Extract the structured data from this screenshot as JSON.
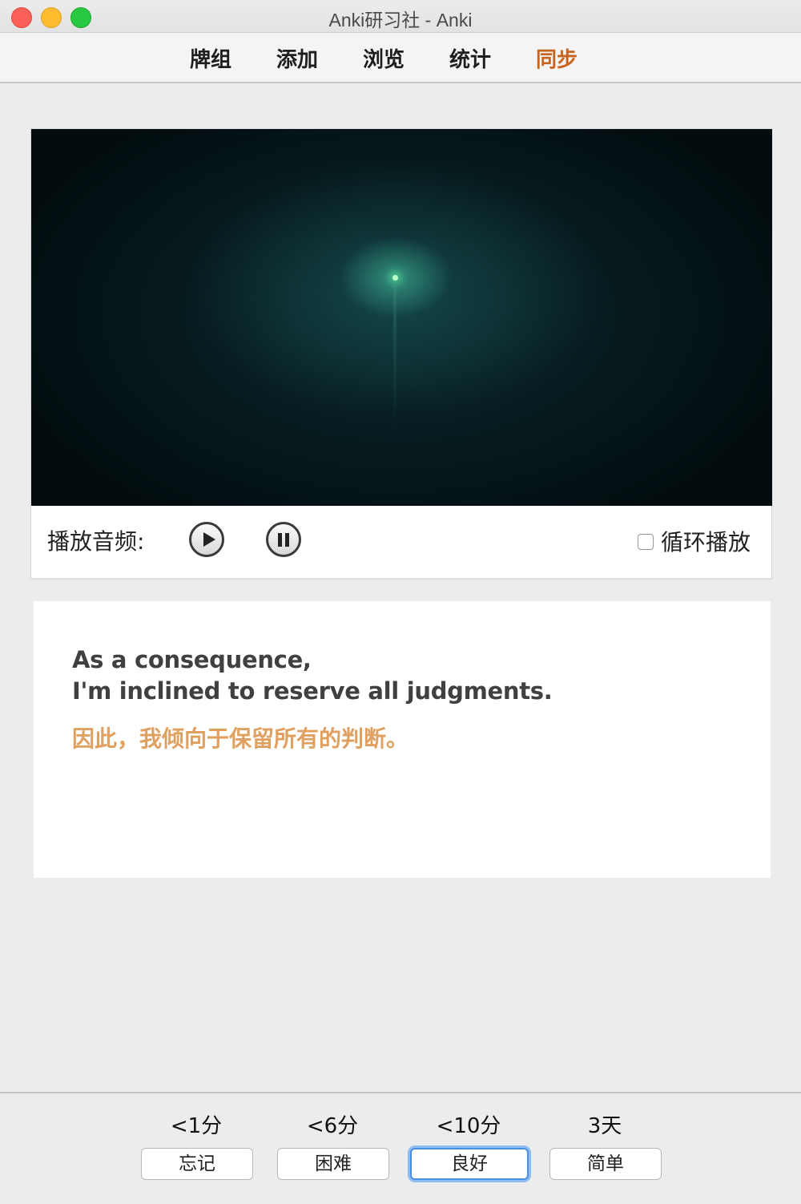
{
  "window": {
    "title": "Anki研习社 - Anki"
  },
  "toolbar": {
    "items": [
      {
        "label": "牌组"
      },
      {
        "label": "添加"
      },
      {
        "label": "浏览"
      },
      {
        "label": "统计"
      },
      {
        "label": "同步"
      }
    ],
    "sync_color": "#c8641e"
  },
  "media": {
    "audio_label": "播放音频:",
    "loop_label": "循环播放",
    "loop_checked": false,
    "play_icon": "play-icon",
    "pause_icon": "pause-icon"
  },
  "card": {
    "english_line1": "As a consequence,",
    "english_line2": "I'm inclined to reserve all judgments.",
    "chinese": "因此，我倾向于保留所有的判断。",
    "chinese_color": "#e0a060"
  },
  "answer": {
    "intervals": [
      "<1分",
      "<6分",
      "<10分",
      "3天"
    ],
    "buttons": [
      "忘记",
      "困难",
      "良好",
      "简单"
    ],
    "focused_index": 2
  }
}
